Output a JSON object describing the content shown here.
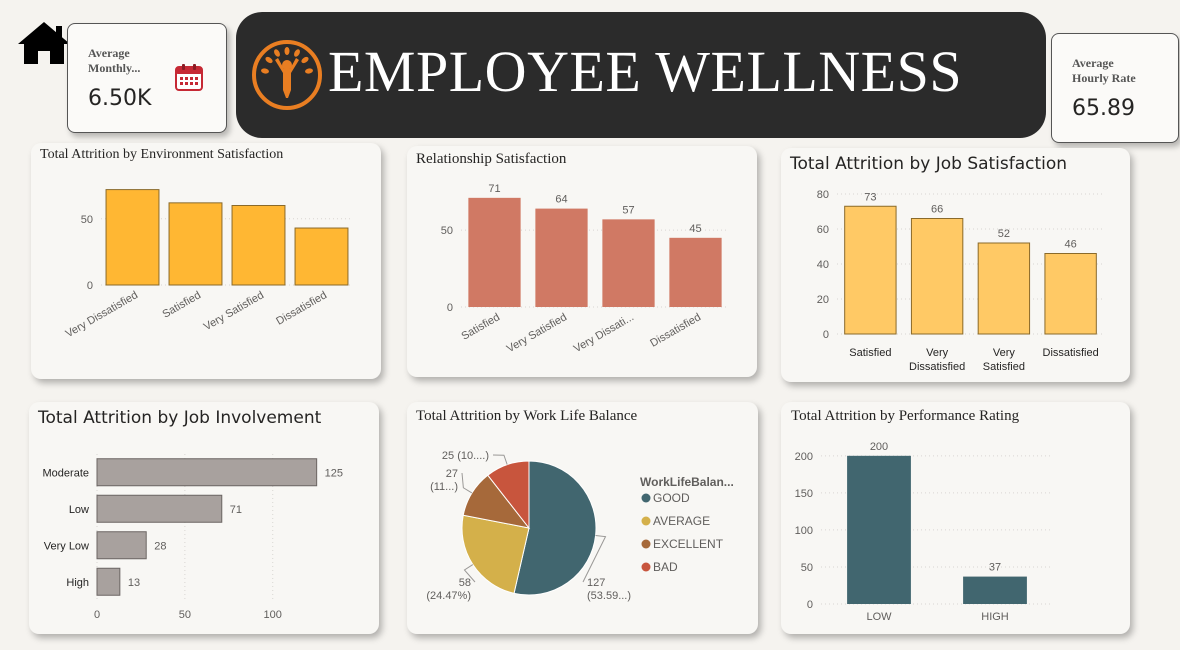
{
  "header": {
    "title": "EMPLOYEE WELLNESS",
    "logo_icon": "person-wellness-icon",
    "home_icon": "home-icon"
  },
  "kpis": {
    "monthly": {
      "label_line1": "Average",
      "label_line2": "Monthly...",
      "value": "6.50K",
      "icon": "calendar-icon"
    },
    "hourly": {
      "label_line1": "Average",
      "label_line2": "Hourly Rate",
      "value": "65.89"
    }
  },
  "colors": {
    "gold": "#ffb733",
    "salmon": "#d07964",
    "light_gold": "#ffc965",
    "gray": "#a8a19e",
    "teal": "#41666f",
    "pie_good": "#41666f",
    "pie_average": "#d4b04a",
    "pie_excellent": "#a6693a",
    "pie_bad": "#c8553d",
    "banner": "#2b2b2b",
    "logo": "#e97e22"
  },
  "chart_data": [
    {
      "id": "env",
      "type": "bar",
      "title": "Total Attrition by Environment Satisfaction",
      "categories": [
        "Very Dissatisfied",
        "Satisfied",
        "Very Satisfied",
        "Dissatisfied"
      ],
      "values": [
        72,
        62,
        60,
        43
      ],
      "ylim": [
        0,
        80
      ],
      "yticks": [
        "0",
        "50"
      ],
      "grid": true
    },
    {
      "id": "rel",
      "type": "bar",
      "title": "Relationship Satisfaction",
      "categories": [
        "Satisfied",
        "Very Satisfied",
        "Very Dissati...",
        "Dissatisfied"
      ],
      "values": [
        71,
        64,
        57,
        45
      ],
      "data_labels": [
        "71",
        "64",
        "57",
        "45"
      ],
      "ylim": [
        0,
        80
      ],
      "yticks": [
        "0",
        "50"
      ],
      "grid": true
    },
    {
      "id": "job",
      "type": "bar",
      "title": "Total Attrition by Job Satisfaction",
      "categories": [
        "Satisfied",
        "Very Dissatisfied",
        "Very Satisfied",
        "Dissatisfied"
      ],
      "category_lines": [
        [
          "Satisfied"
        ],
        [
          "Very",
          "Dissatisfied"
        ],
        [
          "Very",
          "Satisfied"
        ],
        [
          "Dissatisfied"
        ]
      ],
      "values": [
        73,
        66,
        52,
        46
      ],
      "data_labels": [
        "73",
        "66",
        "52",
        "46"
      ],
      "ylim": [
        0,
        80
      ],
      "yticks": [
        "0",
        "20",
        "40",
        "60",
        "80"
      ],
      "grid": true
    },
    {
      "id": "inv",
      "type": "bar",
      "orientation": "horizontal",
      "title": "Total Attrition by Job Involvement",
      "categories": [
        "Moderate",
        "Low",
        "Very Low",
        "High"
      ],
      "values": [
        125,
        71,
        28,
        13
      ],
      "data_labels": [
        "125",
        "71",
        "28",
        "13"
      ],
      "xlim": [
        0,
        136
      ],
      "xticks": [
        "0",
        "50",
        "100"
      ],
      "grid": true
    },
    {
      "id": "wlb",
      "type": "pie",
      "title": "Total Attrition by Work Life Balance",
      "legend_title": "WorkLifeBalan...",
      "legend_position": "right",
      "slices": [
        {
          "name": "GOOD",
          "value": 127,
          "label_value": "127",
          "label_pct": "(53.59...)"
        },
        {
          "name": "AVERAGE",
          "value": 58,
          "label_value": "58",
          "label_pct": "(24.47%)"
        },
        {
          "name": "EXCELLENT",
          "value": 27,
          "label_value": "27",
          "label_pct": "(11...)"
        },
        {
          "name": "BAD",
          "value": 25,
          "label_value": "25 (10....)",
          "label_pct": ""
        }
      ]
    },
    {
      "id": "perf",
      "type": "bar",
      "title": "Total Attrition by Performance Rating",
      "categories": [
        "LOW",
        "HIGH"
      ],
      "values": [
        200,
        37
      ],
      "data_labels": [
        "200",
        "37"
      ],
      "ylim": [
        0,
        220
      ],
      "yticks": [
        "0",
        "50",
        "100",
        "150",
        "200"
      ],
      "grid": true
    }
  ]
}
